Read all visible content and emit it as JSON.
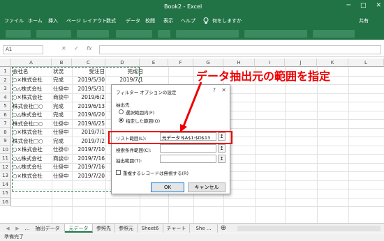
{
  "title_bar": {
    "title": "Book2 - Excel",
    "minimize": "─",
    "maximize": "□",
    "close": "✕"
  },
  "ribbon": {
    "tabs": [
      "ファイル",
      "ホーム",
      "挿入",
      "ページ レイアウト",
      "数式",
      "データ",
      "校閲",
      "表示",
      "ヘルプ"
    ],
    "lightbulb_icon": "lightbulb-icon",
    "tell_me": "何をしますか",
    "share": "共有"
  },
  "formula_bar": {
    "name_box": "A1",
    "cancel": "✕",
    "enter": "✓",
    "fx": "fx",
    "value": ""
  },
  "columns": [
    "A",
    "B",
    "C",
    "D",
    "E",
    "F",
    "G",
    "H",
    "I",
    "J",
    "K",
    "L"
  ],
  "rows": [
    "1",
    "2",
    "3",
    "4",
    "5",
    "6",
    "7",
    "8",
    "9",
    "10",
    "11",
    "12",
    "13",
    "14",
    "15",
    "16"
  ],
  "table": [
    [
      "会社名",
      "状況",
      "受注日",
      "完成日"
    ],
    [
      "○×株式会社",
      "完成",
      "2019/5/30",
      "2019/7/1"
    ],
    [
      "○△株式会社",
      "仕掛中",
      "2019/5/31",
      "2019/7/5"
    ],
    [
      "○×株式会社",
      "商談中",
      "2019/6/2",
      "2019/7/15"
    ],
    [
      "株式会社□○",
      "完成",
      "2019/6/13",
      "2019/7/10"
    ],
    [
      "○△株式会社",
      "完成",
      "2019/6/20",
      "2019/8/1"
    ],
    [
      "株式会社□○",
      "仕掛中",
      "2019/6/25",
      "2019/8/10"
    ],
    [
      "○×株式会社",
      "仕掛中",
      "2019/7/1",
      "2019/8/15"
    ],
    [
      "株式会社□○",
      "完成",
      "2019/7/2",
      "2019/8/20"
    ],
    [
      "○×株式会社",
      "仕掛中",
      "2019/7/10",
      "2019/8/25"
    ],
    [
      "○△株式会社",
      "商談中",
      "2019/7/16",
      "2019/8/30"
    ],
    [
      "○△株式会社",
      "仕掛中",
      "2019/7/16",
      "2019/9/1"
    ],
    [
      "○×株式会社",
      "仕掛中",
      "2019/7/20",
      "2019/9/10"
    ]
  ],
  "dialog": {
    "title": "フィルター オプションの設定",
    "help": "?",
    "close": "✕",
    "extract_group": "抽出先",
    "option_in_place": "選択範囲内(F)",
    "option_copy": "指定した範囲(O)",
    "list_range_label": "リスト範囲(L):",
    "list_range_value": "元データ!$A$1:$D$13",
    "criteria_label": "検索条件範囲(C):",
    "extract_range_label": "抽出範囲(T):",
    "unique_only": "重複するレコードは無視する(R)",
    "ok": "OK",
    "cancel": "キャンセル",
    "ref_icon": "↥"
  },
  "annotation": {
    "text": "データ抽出元の範囲を指定",
    "color": "#e00000"
  },
  "sheet_tabs": [
    "抽出データ",
    "元データ",
    "参照先",
    "参照元",
    "Sheet6",
    "チャート",
    "She ..."
  ],
  "active_tab": "元データ",
  "status": "準備完了",
  "colors": {
    "excel_green": "#217346",
    "accent_red": "#e00000"
  }
}
